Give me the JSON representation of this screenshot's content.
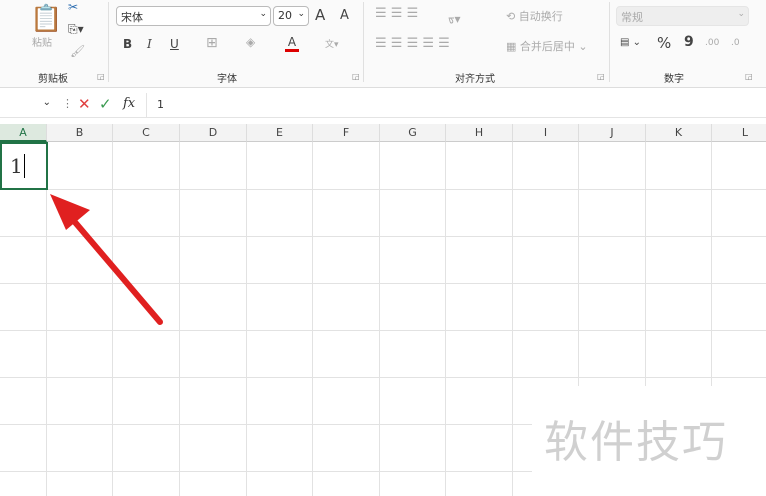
{
  "ribbon": {
    "clipboard": {
      "label": "剪贴板",
      "paste": "粘贴"
    },
    "font": {
      "label": "字体",
      "font_name": "宋体",
      "font_size": "20",
      "bold": "B",
      "italic": "I",
      "underline": "U",
      "grow": "A",
      "shrink": "A",
      "color_a": "A"
    },
    "alignment": {
      "label": "对齐方式",
      "wrap": "自动换行",
      "merge": "合并后居中"
    },
    "number": {
      "label": "数字",
      "format": "常规",
      "percent": "%",
      "comma": "9",
      "inc_dec": ".00",
      "dec_dec": ".0"
    }
  },
  "formula_bar": {
    "cancel": "✕",
    "confirm": "✓",
    "fx": "fx",
    "value": "1"
  },
  "grid": {
    "columns": [
      "A",
      "B",
      "C",
      "D",
      "E",
      "F",
      "G",
      "H",
      "I",
      "J",
      "K",
      "L"
    ],
    "selected_column": "A",
    "active_cell_value": "1"
  },
  "watermark": "软件技巧",
  "colors": {
    "accent": "#217346",
    "arrow": "#e02020"
  }
}
